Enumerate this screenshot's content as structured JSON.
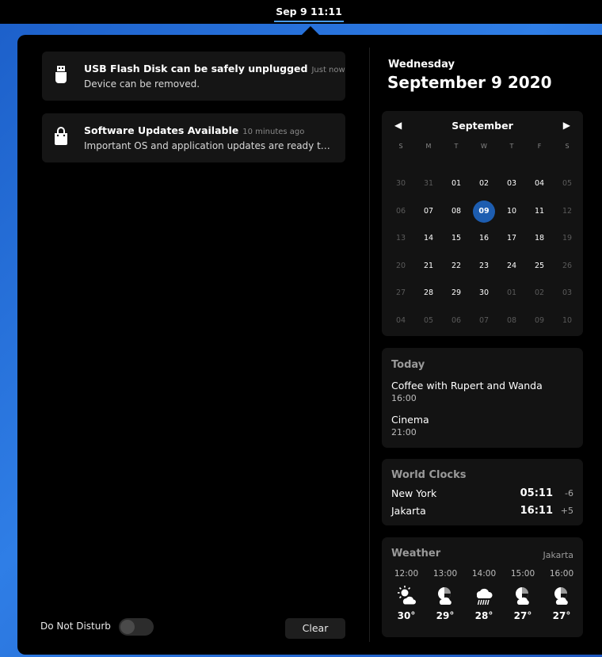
{
  "topbar": {
    "clock": "Sep 9  11:11"
  },
  "notifications": [
    {
      "title": "USB Flash Disk can be safely unplugged",
      "time": "Just now",
      "body": "Device can be removed.",
      "icon": "usb-drive-icon"
    },
    {
      "title": "Software Updates Available",
      "time": "10 minutes ago",
      "body": "Important OS and application updates are ready to …",
      "icon": "shopping-bag-icon"
    }
  ],
  "footer": {
    "dnd_label": "Do Not Disturb",
    "dnd_enabled": false,
    "clear_label": "Clear"
  },
  "date": {
    "weekday": "Wednesday",
    "full": "September 9 2020"
  },
  "calendar": {
    "month": "September",
    "prev_icon": "◀",
    "next_icon": "▶",
    "weekdays": [
      "S",
      "M",
      "T",
      "W",
      "T",
      "F",
      "S"
    ],
    "weeks": [
      [
        "30",
        "31",
        "01",
        "02",
        "03",
        "04",
        "05"
      ],
      [
        "06",
        "07",
        "08",
        "09",
        "10",
        "11",
        "12"
      ],
      [
        "13",
        "14",
        "15",
        "16",
        "17",
        "18",
        "19"
      ],
      [
        "20",
        "21",
        "22",
        "23",
        "24",
        "25",
        "26"
      ],
      [
        "27",
        "28",
        "29",
        "30",
        "01",
        "02",
        "03"
      ],
      [
        "04",
        "05",
        "06",
        "07",
        "08",
        "09",
        "10"
      ]
    ],
    "selected": "09",
    "accent": "#1d5db0"
  },
  "events": {
    "title": "Today",
    "items": [
      {
        "title": "Coffee with Rupert and Wanda",
        "time": "16:00"
      },
      {
        "title": "Cinema",
        "time": "21:00"
      }
    ]
  },
  "world_clocks": {
    "title": "World Clocks",
    "items": [
      {
        "city": "New York",
        "time": "05:11",
        "offset": "-6"
      },
      {
        "city": "Jakarta",
        "time": "16:11",
        "offset": "+5"
      }
    ]
  },
  "weather": {
    "title": "Weather",
    "location": "Jakarta",
    "forecast": [
      {
        "hour": "12:00",
        "icon": "sun-cloud-icon",
        "temp": "30°"
      },
      {
        "hour": "13:00",
        "icon": "partly-cloudy-icon",
        "temp": "29°"
      },
      {
        "hour": "14:00",
        "icon": "rain-icon",
        "temp": "28°"
      },
      {
        "hour": "15:00",
        "icon": "partly-cloudy-icon",
        "temp": "27°"
      },
      {
        "hour": "16:00",
        "icon": "partly-cloudy-icon",
        "temp": "27°"
      }
    ]
  }
}
